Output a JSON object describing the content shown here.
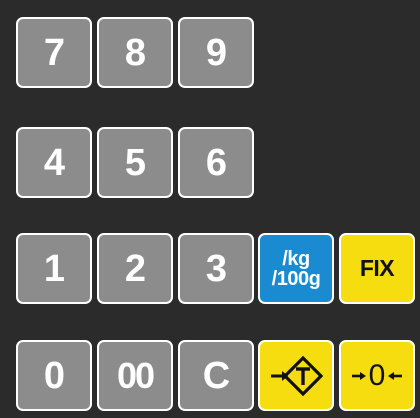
{
  "keypad": {
    "row1": {
      "k7": "7",
      "k8": "8",
      "k9": "9"
    },
    "row2": {
      "k4": "4",
      "k5": "5",
      "k6": "6"
    },
    "row3": {
      "k1": "1",
      "k2": "2",
      "k3": "3",
      "unit_line1": "/kg",
      "unit_line2": "/100g",
      "fix": "FIX"
    },
    "row4": {
      "k0": "0",
      "k00": "00",
      "clear": "C",
      "tare_icon": "tare-arrow-icon",
      "zero_icon": "zero-arrows-icon",
      "zero_digit": "0"
    },
    "colors": {
      "background": "#2b2b2b",
      "gray_key": "#8c8c8c",
      "blue_key": "#1a8ad1",
      "yellow_key": "#f5dd0f",
      "border": "#ffffff"
    }
  }
}
